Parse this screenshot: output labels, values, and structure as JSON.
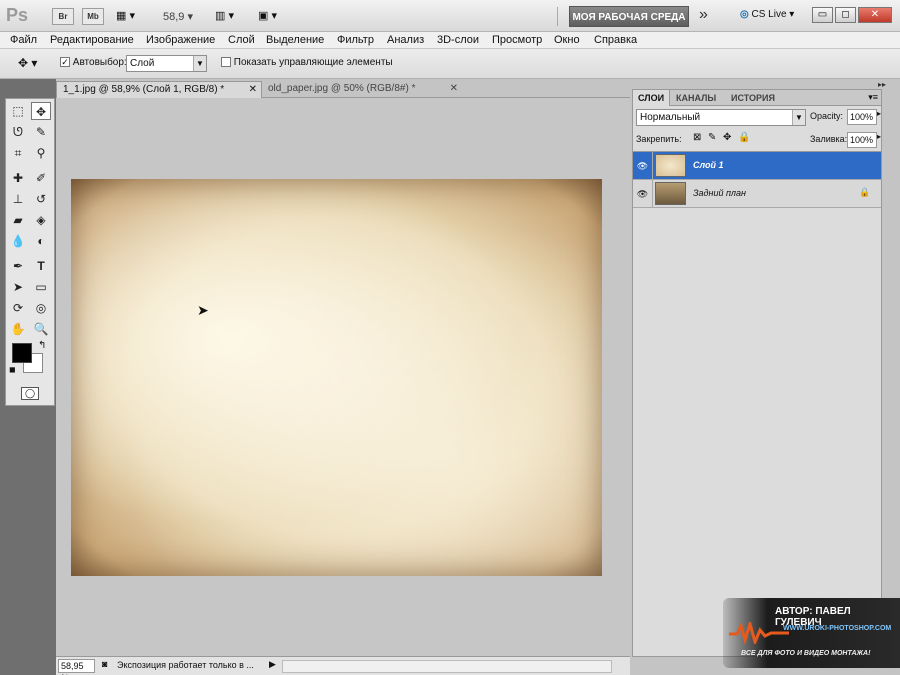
{
  "app": {
    "logo": "Ps",
    "btn_br": "Br",
    "btn_mb": "Mb",
    "zoom": "58,9",
    "workspace": "МОЯ РАБОЧАЯ СРЕДА",
    "more": "»",
    "cslive": "CS Live",
    "win_min": "▭",
    "win_max": "◻",
    "win_close": "✕"
  },
  "menu": [
    "Файл",
    "Редактирование",
    "Изображение",
    "Слой",
    "Выделение",
    "Фильтр",
    "Анализ",
    "3D-слои",
    "Просмотр",
    "Окно",
    "Справка"
  ],
  "options": {
    "autoselect_label": "Автовыбор:",
    "autoselect_value": "Слой",
    "show_controls": "Показать управляющие элементы"
  },
  "tabs": [
    {
      "label": "1_1.jpg @ 58,9% (Слой 1, RGB/8) *",
      "active": true
    },
    {
      "label": "old_paper.jpg @ 50% (RGB/8#) *",
      "active": false
    }
  ],
  "status": {
    "zoom": "58,95 %",
    "info": "Экспозиция работает только в ..."
  },
  "panel": {
    "tabs": [
      "СЛОИ",
      "КАНАЛЫ",
      "ИСТОРИЯ"
    ],
    "blend_mode": "Нормальный",
    "opacity_label": "Opacity:",
    "opacity_value": "100%",
    "lock_label": "Закрепить:",
    "fill_label": "Заливка:",
    "fill_value": "100%",
    "layers": [
      {
        "name": "Слой 1",
        "selected": true,
        "locked": false
      },
      {
        "name": "Задний план",
        "selected": false,
        "locked": true
      }
    ]
  },
  "watermark": {
    "author": "АВТОР: ПАВЕЛ ГУЛЕВИЧ",
    "url": "WWW.UROKI-PHOTOSHOP.COM",
    "slogan": "ВСЕ ДЛЯ ФОТО И ВИДЕО МОНТАЖА!"
  },
  "colors": {
    "selection_blue": "#2e6bc6",
    "workspace_button": "#6b6b6b",
    "foreground": "#000000",
    "background": "#ffffff"
  }
}
